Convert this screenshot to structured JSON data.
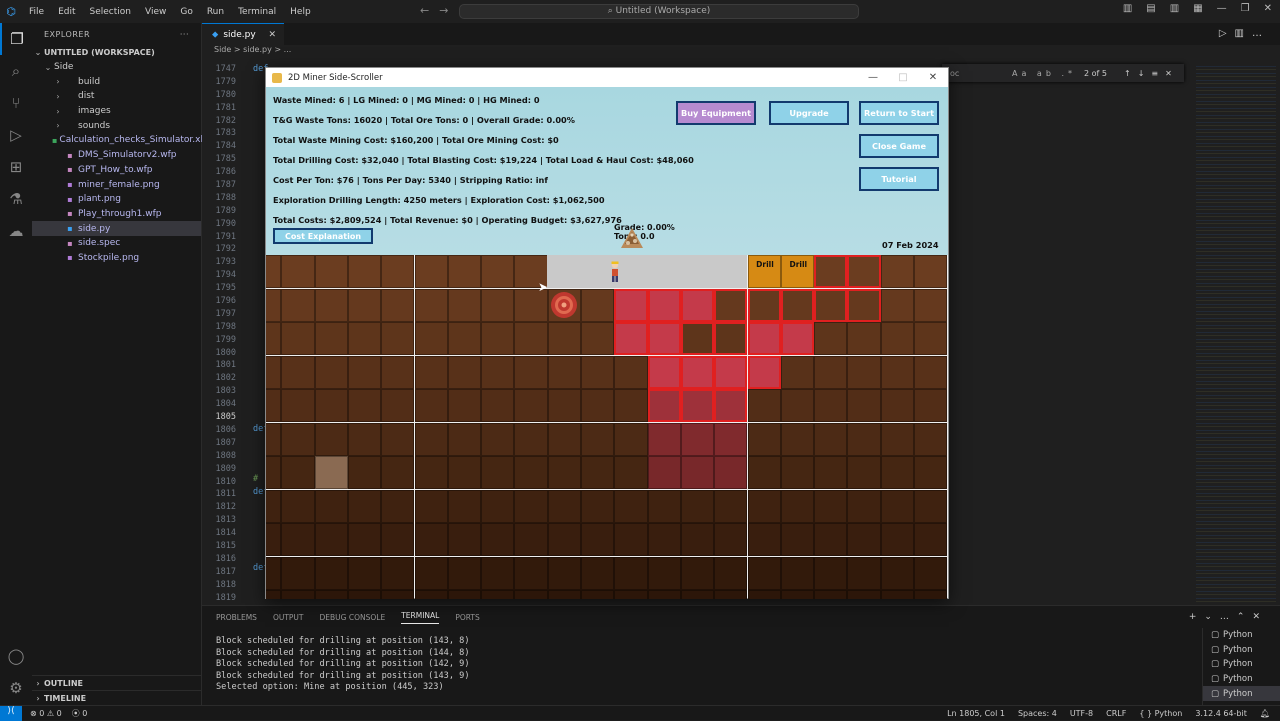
{
  "titlebar": {
    "menu": [
      "File",
      "Edit",
      "Selection",
      "View",
      "Go",
      "Run",
      "Terminal",
      "Help"
    ],
    "search": "Untitled (Workspace)"
  },
  "explorer": {
    "header": "EXPLORER",
    "workspace": "UNTITLED (WORKSPACE)",
    "root_folder": "Side",
    "items": [
      {
        "label": "build",
        "type": "folder"
      },
      {
        "label": "dist",
        "type": "folder"
      },
      {
        "label": "images",
        "type": "folder"
      },
      {
        "label": "sounds",
        "type": "folder"
      },
      {
        "label": "Calculation_checks_Simulator.xlsx",
        "type": "file"
      },
      {
        "label": "DMS_Simulatorv2.wfp",
        "type": "file"
      },
      {
        "label": "GPT_How_to.wfp",
        "type": "file"
      },
      {
        "label": "miner_female.png",
        "type": "file"
      },
      {
        "label": "plant.png",
        "type": "file"
      },
      {
        "label": "Play_through1.wfp",
        "type": "file"
      },
      {
        "label": "side.py",
        "type": "file",
        "selected": true
      },
      {
        "label": "side.spec",
        "type": "file"
      },
      {
        "label": "Stockpile.png",
        "type": "file"
      }
    ],
    "outline": "OUTLINE",
    "timeline": "TIMELINE"
  },
  "editor": {
    "tab": "side.py",
    "breadcrumb": "Side  >  side.py  >  ...",
    "find": {
      "placeholder": "oc",
      "count": "2 of 5"
    },
    "line_numbers": [
      "1747",
      "1779",
      "1780",
      "1781",
      "1782",
      "1783",
      "1784",
      "1785",
      "1786",
      "1787",
      "1788",
      "1789",
      "1790",
      "1791",
      "1792",
      "1793",
      "1794",
      "1795",
      "1796",
      "1797",
      "1798",
      "1799",
      "1800",
      "1801",
      "1802",
      "1803",
      "1804",
      "1805",
      "1806",
      "1807",
      "1808",
      "1809",
      "1810",
      "1811",
      "1812",
      "1813",
      "1814",
      "1815",
      "1816",
      "1817",
      "1818",
      "1819"
    ],
    "current_line": "1805"
  },
  "panel": {
    "tabs": [
      "PROBLEMS",
      "OUTPUT",
      "DEBUG CONSOLE",
      "TERMINAL",
      "PORTS"
    ],
    "active_tab": "TERMINAL",
    "terminal_lines": [
      "Block scheduled for drilling at position (143, 8)",
      "Block scheduled for drilling at position (144, 8)",
      "Block scheduled for drilling at position (142, 9)",
      "Block scheduled for drilling at position (143, 9)",
      "Selected option: Mine at position (445, 323)"
    ],
    "terminals": [
      "Python",
      "Python",
      "Python",
      "Python",
      "Python"
    ]
  },
  "statusbar": {
    "errors": "0",
    "warnings": "0",
    "ports": "0",
    "position": "Ln 1805, Col 1",
    "spaces": "Spaces: 4",
    "encoding": "UTF-8",
    "eol": "CRLF",
    "language": "Python",
    "interpreter": "3.12.4 64-bit"
  },
  "game": {
    "title": "2D Miner Side-Scroller",
    "stats": [
      "Waste Mined: 6 | LG Mined: 0 | MG Mined: 0 | HG Mined: 0",
      "T&G Waste Tons: 16020 | Total Ore Tons: 0 | Overall Grade: 0.00%",
      "Total Waste Mining Cost: $160,200 | Total Ore Mining Cost: $0",
      "Total Drilling Cost: $32,040 | Total Blasting Cost: $19,224 | Total Load & Haul Cost: $48,060",
      "Cost Per Ton: $76 | Tons Per Day: 5340 | Stripping Ratio: inf",
      "Exploration Drilling Length: 4250 meters | Exploration Cost: $1,062,500",
      "Total Costs: $2,809,524 | Total Revenue: $0 | Operating Budget: $3,627,976"
    ],
    "buttons": {
      "buy": "Buy Equipment",
      "upgrade": "Upgrade",
      "return": "Return to Start",
      "close": "Close Game",
      "tutorial": "Tutorial",
      "cost": "Cost Explanation"
    },
    "grade": "Grade: 0.00%",
    "tons": "Tons: 0.0",
    "date": "07 Feb 2024",
    "drill_label": "Drill",
    "colors": {
      "dirt_top": "#6b3d20",
      "dirt_deep": "#2c1609",
      "scheduled": "#c43a4a",
      "drill": "#d68a14",
      "hud": "#aed9e1",
      "button_purple": "#b68bd0",
      "button_blue": "#8fd2e8"
    }
  }
}
